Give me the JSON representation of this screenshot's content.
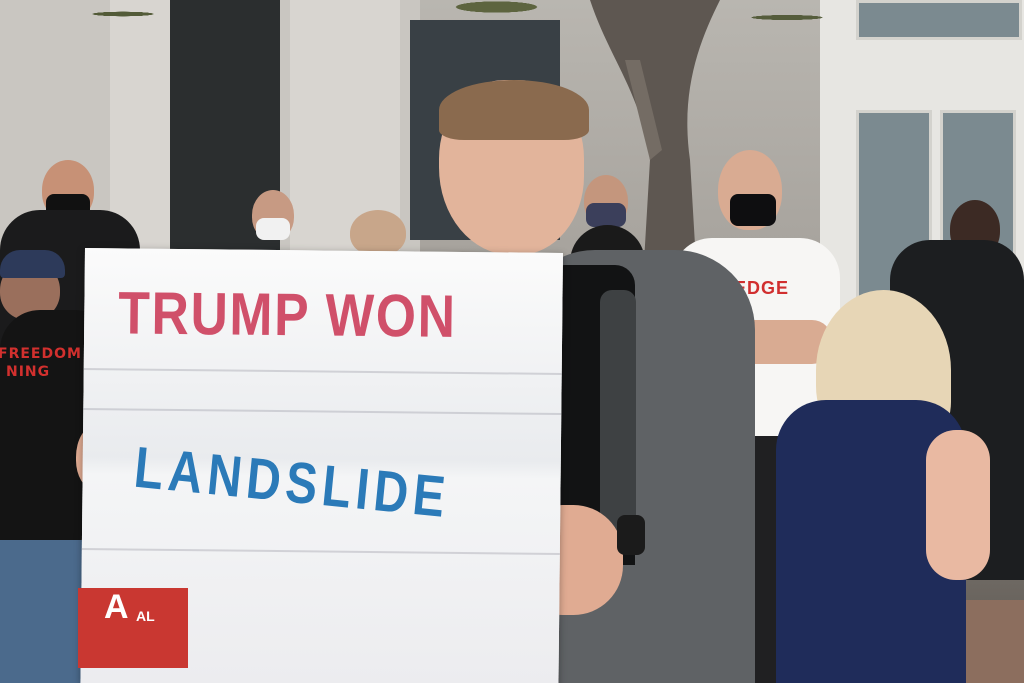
{
  "photo": {
    "subject": "Trump supporter holding protest sign",
    "sign": {
      "line1": "TRUMP WON",
      "line2": "LANDSLIDE",
      "line1_color": "#d0506a",
      "line2_color": "#2b7ab8"
    },
    "tshirt_text": {
      "brand": "EDGE"
    },
    "shirt_text_left": "FREEDOM",
    "shirt_text_left_2": "NING",
    "box_text": "A",
    "box_text_2": "AL"
  }
}
